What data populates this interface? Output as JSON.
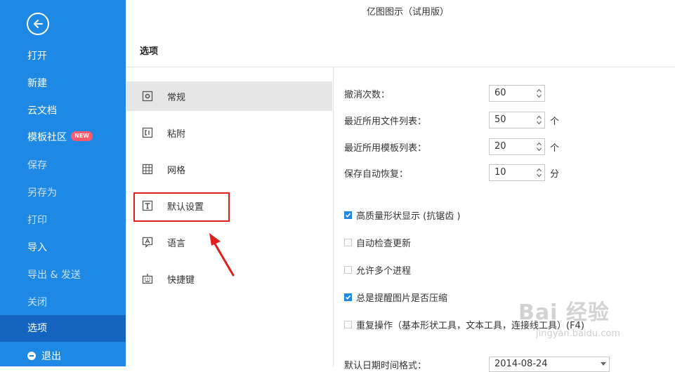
{
  "app_title": "亿图图示（试用版）",
  "sidebar": {
    "items": [
      {
        "label": "打开"
      },
      {
        "label": "新建"
      },
      {
        "label": "云文档"
      },
      {
        "label": "模板社区",
        "badge": "NEW"
      },
      {
        "label": "保存"
      },
      {
        "label": "另存为"
      },
      {
        "label": "打印"
      },
      {
        "label": "导入"
      },
      {
        "label": "导出 & 发送"
      },
      {
        "label": "关闭"
      },
      {
        "label": "选项"
      },
      {
        "label": "退出"
      }
    ]
  },
  "options": {
    "title": "选项",
    "categories": [
      {
        "label": "常规",
        "icon": "gear-icon"
      },
      {
        "label": "粘附",
        "icon": "snap-icon"
      },
      {
        "label": "网格",
        "icon": "grid-icon"
      },
      {
        "label": "默认设置",
        "icon": "text-icon"
      },
      {
        "label": "语言",
        "icon": "language-icon"
      },
      {
        "label": "快捷键",
        "icon": "keyboard-icon"
      }
    ]
  },
  "general": {
    "undo_label": "撤消次数：",
    "undo_value": "60",
    "recent_files_label": "最近所用文件列表：",
    "recent_files_value": "50",
    "recent_files_unit": "个",
    "recent_templates_label": "最近所用模板列表：",
    "recent_templates_value": "20",
    "recent_templates_unit": "个",
    "autosave_label": "保存自动恢复：",
    "autosave_value": "10",
    "autosave_unit": "分",
    "checkboxes": [
      {
        "label": "高质量形状显示 (抗锯齿 )",
        "checked": true
      },
      {
        "label": "自动检查更新",
        "checked": false
      },
      {
        "label": "允许多个进程",
        "checked": false
      },
      {
        "label": "总是提醒图片是否压缩",
        "checked": true
      },
      {
        "label": "重复操作（基本形状工具，文本工具，连接线工具）(F4)",
        "checked": false
      }
    ],
    "date_format_label": "默认日期时间格式：",
    "date_format_value": "2014-08-24"
  },
  "watermark": {
    "text": "Bai 经验",
    "url": "jingyan.baidu.com"
  },
  "colors": {
    "sidebar": "#1e88e5",
    "sidebar_active": "#1565c0",
    "annotation": "#e02020"
  }
}
